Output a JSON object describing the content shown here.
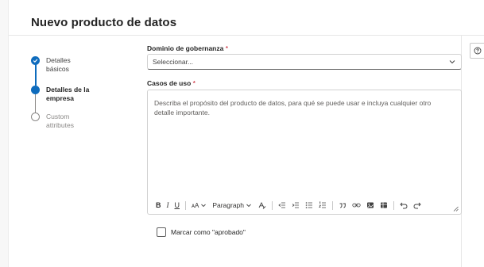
{
  "dialog": {
    "title": "Nuevo producto de datos"
  },
  "steps": [
    {
      "label": "Detalles básicos",
      "state": "completed"
    },
    {
      "label": "Detalles de la empresa",
      "state": "current"
    },
    {
      "label": "Custom attributes",
      "state": "pending"
    }
  ],
  "form": {
    "governance_domain": {
      "label": "Dominio de gobernanza",
      "required_mark": "*",
      "value": "Seleccionar..."
    },
    "use_cases": {
      "label": "Casos de uso",
      "required_mark": "*",
      "placeholder": "Describa el propósito del producto de datos, para qué se puede usar e incluya cualquier otro detalle importante."
    },
    "toolbar": {
      "bold": "B",
      "italic": "I",
      "underline": "U",
      "font_size": "ᴀA",
      "paragraph": "Paragraph"
    },
    "approved_checkbox": {
      "label": "Marcar como \"aprobado\"",
      "checked": false
    }
  },
  "colors": {
    "accent": "#0f6cbd",
    "required": "#c50f1f",
    "border": "#d1d1d1"
  },
  "icons": [
    "checkmark-icon",
    "chevron-down-icon",
    "help-icon",
    "font-size-icon",
    "highlight-icon",
    "outdent-icon",
    "indent-icon",
    "bullet-list-icon",
    "numbered-list-icon",
    "quote-icon",
    "link-icon",
    "image-icon",
    "table-icon",
    "undo-icon",
    "redo-icon",
    "resize-grip-icon"
  ]
}
